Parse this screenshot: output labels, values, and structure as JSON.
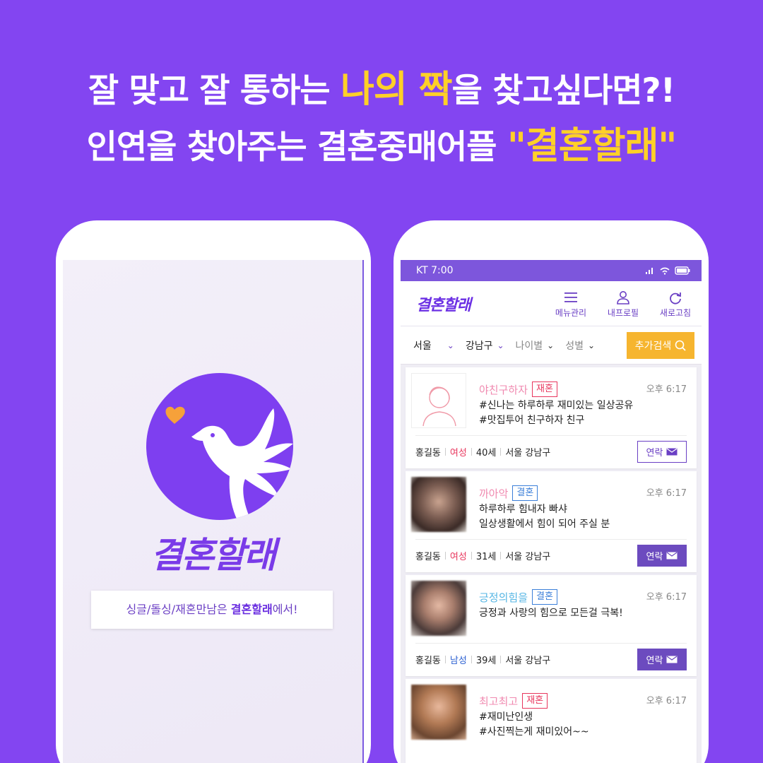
{
  "headline": {
    "line1_before": "잘 맞고 잘 통하는 ",
    "line1_highlight": "나의 짝",
    "line1_after": "을 찾고싶다면?!",
    "line2_before": "인연을 찾아주는 결혼중매어플 ",
    "line2_highlight": "\"결혼할래\""
  },
  "splash": {
    "brand": "결혼할래",
    "tagline_before": "싱글/돌싱/재혼만남은 ",
    "tagline_bold": "결혼할래",
    "tagline_after": "에서!"
  },
  "app": {
    "status": {
      "carrier_time": "KT 7:00"
    },
    "brand": "결혼할래",
    "nav": [
      {
        "label": "메뉴관리",
        "icon": "menu-icon"
      },
      {
        "label": "내프로필",
        "icon": "profile-icon"
      },
      {
        "label": "새로고침",
        "icon": "refresh-icon"
      }
    ],
    "filters": {
      "city": "서울",
      "district": "강남구",
      "age": "나이별",
      "gender": "성별",
      "search_button": "추가검색"
    },
    "contact_label": "연락",
    "cards": [
      {
        "nickname": "야친구하자",
        "tag": "재혼",
        "time": "오후 6:17",
        "msg1": "#신나는 하루하루 재미있는 일상공유",
        "msg2": "#맛집투어 친구하자 친구",
        "name": "홍길동",
        "gender": "여성",
        "age": "40세",
        "location": "서울 강남구"
      },
      {
        "nickname": "까아악",
        "tag": "결혼",
        "time": "오후 6:17",
        "msg1": "하루하루 힘내자 빠샤",
        "msg2": "일상생활에서 힘이 되어 주실 분",
        "name": "홍길동",
        "gender": "여성",
        "age": "31세",
        "location": "서울 강남구"
      },
      {
        "nickname": "긍정의힘을",
        "tag": "결혼",
        "time": "오후 6:17",
        "msg1": "긍정과 사랑의 힘으로 모든걸 극복!",
        "msg2": "",
        "name": "홍길동",
        "gender": "남성",
        "age": "39세",
        "location": "서울 강남구"
      },
      {
        "nickname": "최고최고",
        "tag": "재혼",
        "time": "오후 6:17",
        "msg1": "#재미난인생",
        "msg2": "#사진찍는게 재미있어~~"
      }
    ]
  },
  "colors": {
    "background": "#8345f1",
    "accent": "#ffd028",
    "brand": "#6b2fe4",
    "remarriage": "#e8365d",
    "marriage": "#3b7fd9"
  }
}
